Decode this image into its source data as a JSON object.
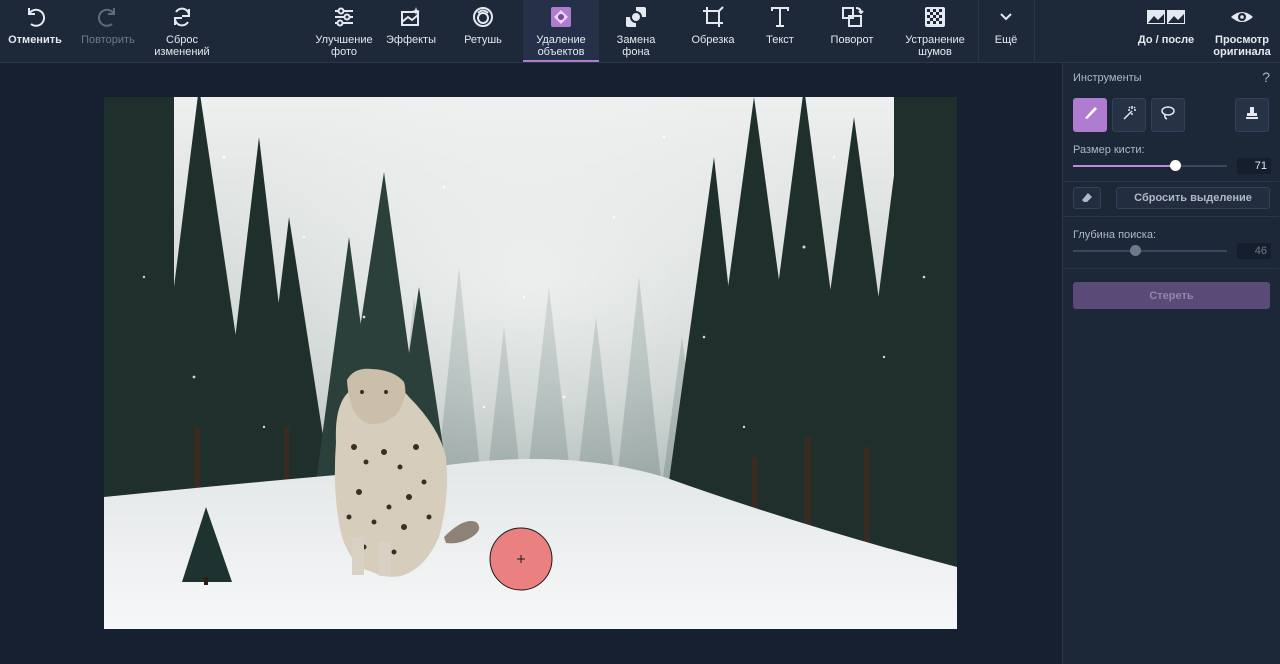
{
  "toolbar": {
    "undo": "Отменить",
    "redo": "Повторить",
    "reset": "Сброс\nизменений",
    "enhance": "Улучшение\nфото",
    "effects": "Эффекты",
    "retouch": "Ретушь",
    "remove_objects": "Удаление\nобъектов",
    "replace_bg": "Замена\nфона",
    "crop": "Обрезка",
    "text": "Текст",
    "rotate": "Поворот",
    "denoise": "Устранение\nшумов",
    "more": "Ещё",
    "before_after": "До / после",
    "preview_original": "Просмотр\nоригинала"
  },
  "panel": {
    "title": "Инструменты",
    "help": "?",
    "brush_size_label": "Размер кисти:",
    "brush_size_value": "71",
    "brush_size_fraction": 0.66,
    "reset_selection": "Сбросить выделение",
    "search_depth_label": "Глубина поиска:",
    "search_depth_value": "46",
    "search_depth_fraction": 0.4,
    "erase": "Стереть"
  },
  "colors": {
    "accent": "#b07cd0",
    "brush_marker": "#ea8080"
  }
}
